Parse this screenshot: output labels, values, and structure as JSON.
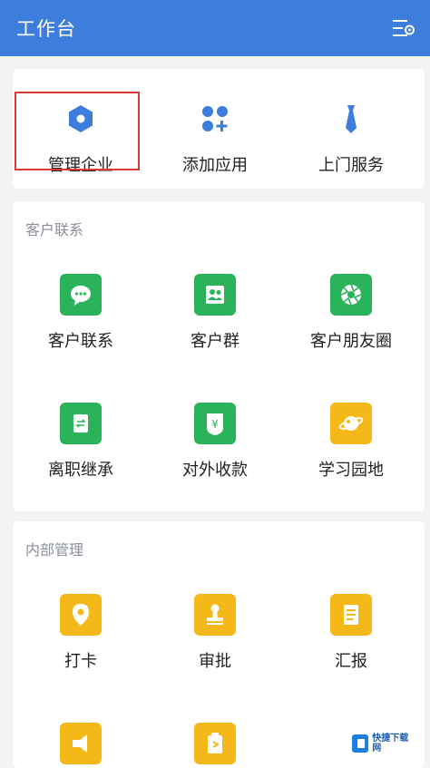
{
  "header": {
    "title": "工作台"
  },
  "top_actions": [
    {
      "label": "管理企业"
    },
    {
      "label": "添加应用"
    },
    {
      "label": "上门服务"
    }
  ],
  "customer_section": {
    "title": "客户联系",
    "items": [
      {
        "label": "客户联系",
        "icon": "chat-icon",
        "color": "#2bb35a"
      },
      {
        "label": "客户群",
        "icon": "group-icon",
        "color": "#2bb35a"
      },
      {
        "label": "客户朋友圈",
        "icon": "moments-icon",
        "color": "#2bb35a"
      },
      {
        "label": "离职继承",
        "icon": "transfer-icon",
        "color": "#2bb35a"
      },
      {
        "label": "对外收款",
        "icon": "payment-icon",
        "color": "#2bb35a"
      },
      {
        "label": "学习园地",
        "icon": "planet-icon",
        "color": "#f5b819"
      }
    ]
  },
  "internal_section": {
    "title": "内部管理",
    "items": [
      {
        "label": "打卡",
        "icon": "location-icon",
        "color": "#f5b819"
      },
      {
        "label": "审批",
        "icon": "stamp-icon",
        "color": "#f5b819"
      },
      {
        "label": "汇报",
        "icon": "report-icon",
        "color": "#f5b819"
      }
    ]
  },
  "watermark": {
    "text": "快捷下载网"
  },
  "colors": {
    "header": "#3d7ddb",
    "accent_blue": "#3d7ddb",
    "green": "#2bb35a",
    "yellow": "#f5b819",
    "highlight": "#d93a33"
  }
}
